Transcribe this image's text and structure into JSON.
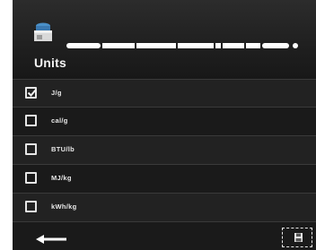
{
  "header": {
    "title": "Units",
    "app_icon": "app-icon",
    "progress_colors": {
      "bar": "#ffffff",
      "track": "#1b1b1b"
    }
  },
  "units": [
    {
      "label": "J/g",
      "checked": true
    },
    {
      "label": "cal/g",
      "checked": false
    },
    {
      "label": "BTU/lb",
      "checked": false
    },
    {
      "label": "MJ/kg",
      "checked": false
    },
    {
      "label": "kWh/kg",
      "checked": false
    }
  ],
  "footer": {
    "back_icon": "back-arrow-icon",
    "save_icon": "save-icon"
  }
}
